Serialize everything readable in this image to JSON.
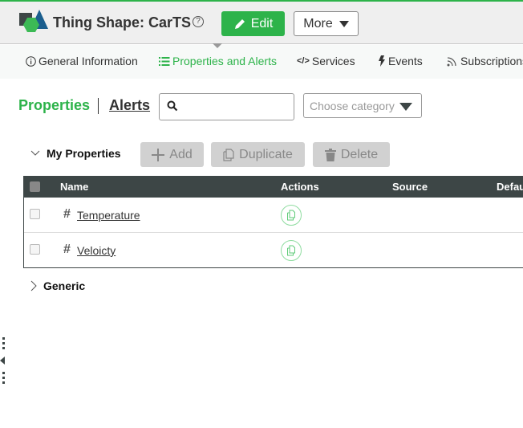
{
  "header": {
    "title": "Thing Shape: CarTS",
    "help_glyph": "?",
    "edit_label": "Edit",
    "more_label": "More"
  },
  "tabs": [
    {
      "label": "General Information",
      "icon": "info-icon",
      "active": false
    },
    {
      "label": "Properties and Alerts",
      "icon": "list-icon",
      "active": true
    },
    {
      "label": "Services",
      "icon": "code-icon",
      "active": false
    },
    {
      "label": "Events",
      "icon": "lightning-icon",
      "active": false
    },
    {
      "label": "Subscriptions",
      "icon": "rss-icon",
      "active": false
    }
  ],
  "subnav": {
    "properties_label": "Properties",
    "alerts_label": "Alerts"
  },
  "search": {
    "value": "",
    "placeholder": ""
  },
  "category": {
    "placeholder": "Choose category"
  },
  "groups": {
    "my_properties": {
      "label": "My Properties",
      "expanded": true
    },
    "generic": {
      "label": "Generic",
      "expanded": false
    }
  },
  "toolbar": {
    "add_label": "Add",
    "duplicate_label": "Duplicate",
    "delete_label": "Delete"
  },
  "table": {
    "columns": [
      "Name",
      "Actions",
      "Source",
      "Defau"
    ],
    "rows": [
      {
        "type_glyph": "#",
        "name": "Temperature",
        "source": "",
        "default": ""
      },
      {
        "type_glyph": "#",
        "name": "Veloicty",
        "source": "",
        "default": ""
      }
    ]
  },
  "colors": {
    "brand_green": "#2db34a",
    "header_dark": "#3d4646",
    "logo_blue": "#1a5e8e"
  }
}
